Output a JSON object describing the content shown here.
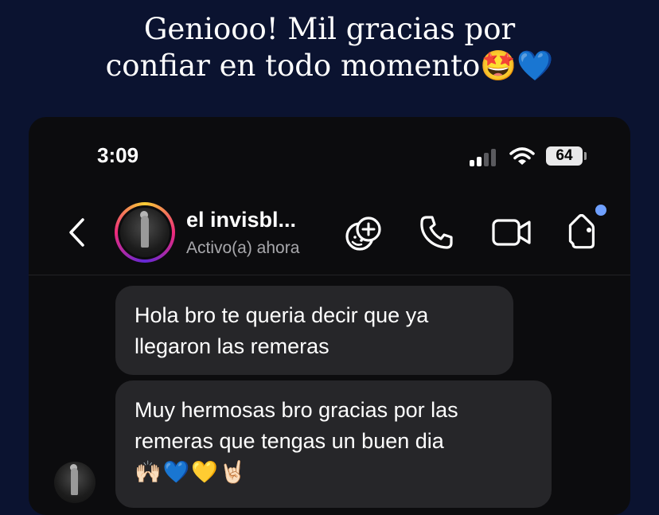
{
  "caption": {
    "line1": "Geniooo! Mil gracias por",
    "line2": "confiar en todo momento🤩💙"
  },
  "status_bar": {
    "time": "3:09",
    "battery": "64",
    "signal_icon": "cellular-signal-icon",
    "wifi_icon": "wifi-icon"
  },
  "header": {
    "contact_name": "el invisbl...",
    "contact_status": "Activo(a) ahora",
    "icons": [
      "back-chevron-icon",
      "effects-sticker-icon",
      "phone-call-icon",
      "video-call-icon",
      "tag-icon"
    ],
    "notification_dot_color": "#6fa0ff"
  },
  "messages": [
    {
      "text_line1": "Hola bro te queria decir que ya",
      "text_line2": "llegaron las remeras"
    },
    {
      "text_line1": "Muy hermosas bro gracias por las",
      "text_line2": "remeras que tengas un buen dia",
      "emojis": "🙌🏻💙💛🤘🏻"
    }
  ],
  "colors": {
    "background": "#0b1330",
    "bubble": "#262629",
    "phone_bg": "#0c0c0e"
  }
}
